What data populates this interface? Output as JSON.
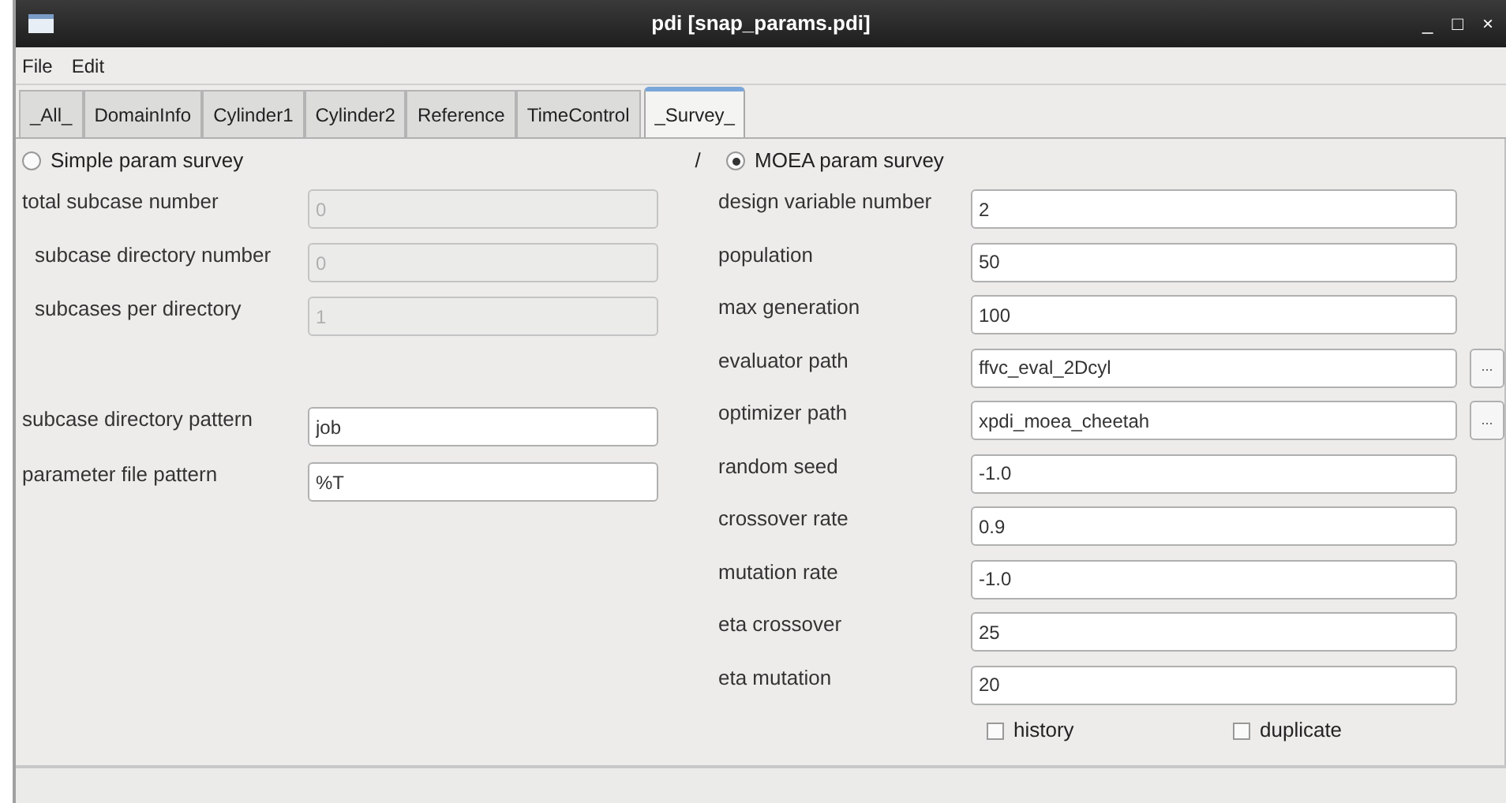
{
  "window": {
    "title": "pdi [snap_params.pdi]",
    "controls": [
      "_",
      "□",
      "×"
    ]
  },
  "menu": [
    "File",
    "Edit"
  ],
  "tabs": [
    {
      "label": "_All_",
      "selected": false
    },
    {
      "label": "DomainInfo",
      "selected": false
    },
    {
      "label": "Cylinder1",
      "selected": false
    },
    {
      "label": "Cylinder2",
      "selected": false
    },
    {
      "label": "Reference",
      "selected": false
    },
    {
      "label": "TimeControl",
      "selected": false
    },
    {
      "label": "_Survey_",
      "selected": true
    }
  ],
  "modes": [
    {
      "label": "Simple param survey",
      "selected": false
    },
    {
      "label": "MOEA param survey",
      "selected": true
    }
  ],
  "separator": "/",
  "simple_fields": [
    {
      "label": "total subcase number",
      "value": "0",
      "disabled": true,
      "children": [
        {
          "label": "subcase directory number",
          "value": "0",
          "disabled": true
        },
        {
          "label": "subcases per directory",
          "value": "1",
          "disabled": true
        }
      ]
    }
  ],
  "pattern_fields": [
    {
      "label": "subcase directory pattern",
      "value": "job",
      "disabled": false
    },
    {
      "label": "parameter file pattern",
      "value": "%T",
      "disabled": false
    }
  ],
  "moea_fields": [
    {
      "label": "design variable number",
      "value": "2"
    },
    {
      "label": "population",
      "value": "50"
    },
    {
      "label": "max generation",
      "value": "100"
    },
    {
      "label": "evaluator path",
      "value": "ffvc_eval_2Dcyl",
      "browse": "..."
    },
    {
      "label": "optimizer path",
      "value": "xpdi_moea_cheetah",
      "browse": "..."
    },
    {
      "label": "random seed",
      "value": "-1.0"
    },
    {
      "label": "crossover rate",
      "value": "0.9"
    },
    {
      "label": "mutation rate",
      "value": "-1.0"
    },
    {
      "label": "eta crossover",
      "value": "25"
    },
    {
      "label": "eta mutation",
      "value": "20"
    }
  ],
  "options": [
    {
      "label": "history",
      "checked": false
    },
    {
      "label": "duplicate",
      "checked": false
    }
  ]
}
